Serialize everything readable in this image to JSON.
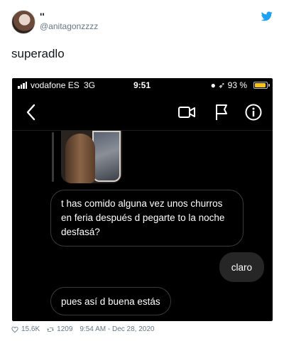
{
  "tweet": {
    "display_name": "''",
    "handle": "@anitagonzzzz",
    "text": "superadlo",
    "likes": "15.6K",
    "retweets": "1209",
    "timestamp": "9:54 AM - Dec 28, 2020"
  },
  "status_bar": {
    "carrier": "vodafone ES",
    "network": "3G",
    "time": "9:51",
    "status_icons": "● ➶ 93 %",
    "battery_level": 0.93
  },
  "messages": [
    {
      "sender": "other",
      "text": "t has comido alguna vez unos churros en feria después d pegarte to la noche desfasá?"
    },
    {
      "sender": "me",
      "text": "claro"
    },
    {
      "sender": "other",
      "text": "pues así d buena estás"
    }
  ],
  "colors": {
    "twitter_blue": "#1da1f2",
    "sent_bubble": "#262626",
    "battery_yellow": "#f5c518"
  },
  "icons": [
    "bird-icon",
    "back-chevron-icon",
    "video-call-icon",
    "flag-icon",
    "info-icon",
    "heart-icon",
    "retweet-icon"
  ]
}
